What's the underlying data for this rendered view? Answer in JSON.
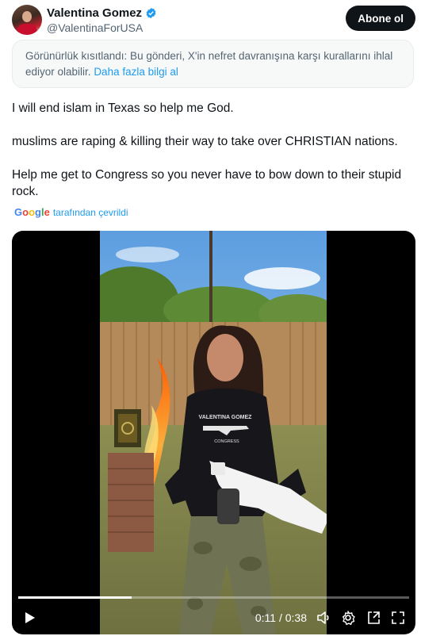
{
  "author": {
    "name": "Valentina Gomez",
    "handle": "@ValentinaForUSA",
    "verified_icon": "verified-badge-icon",
    "brand_color": "#1d9bf0"
  },
  "follow_label": "Abone ol",
  "notice": {
    "text": "Görünürlük kısıtlandı: Bu gönderi, X'in nefret davranışına karşı kurallarını ihlal ediyor olabilir.",
    "link": "Daha fazla bilgi al"
  },
  "tweet": {
    "lines": [
      "I will end islam in Texas so help me God.",
      "muslims are raping & killing their way to take over CHRISTIAN nations.",
      "Help me get to Congress so you never have to bow down to their stupid rock."
    ]
  },
  "translation": {
    "logo_text": "Google",
    "by_text": "tarafından çevrildi"
  },
  "video": {
    "shirt_text": "VALENTINA GOMEZ",
    "shirt_subtext": "CONGRESS",
    "time_display": "0:11 / 0:38",
    "progress_fraction": 0.29,
    "icons": [
      "play-icon",
      "volume-icon",
      "settings-icon",
      "pip-icon",
      "fullscreen-icon"
    ]
  }
}
